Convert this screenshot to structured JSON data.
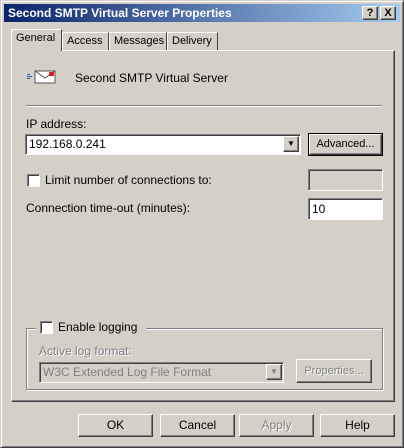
{
  "window": {
    "title": "Second SMTP Virtual Server Properties",
    "help_btn": "?",
    "close_btn": "X"
  },
  "tabs": [
    "General",
    "Access",
    "Messages",
    "Delivery"
  ],
  "active_tab": "General",
  "server": {
    "name": "Second SMTP Virtual Server",
    "icon": "mail-server-icon"
  },
  "ip": {
    "label": "IP address:",
    "value": "192.168.0.241",
    "advanced_btn": "Advanced..."
  },
  "limit": {
    "label": "Limit number of connections to:",
    "checked": false,
    "value": ""
  },
  "timeout": {
    "label": "Connection time-out (minutes):",
    "value": "10"
  },
  "logging": {
    "label": "Enable logging",
    "checked": false,
    "format_label": "Active log format:",
    "format_value": "W3C Extended Log File Format",
    "properties_btn": "Properties..."
  },
  "footer": {
    "ok": "OK",
    "cancel": "Cancel",
    "apply": "Apply",
    "help": "Help"
  }
}
